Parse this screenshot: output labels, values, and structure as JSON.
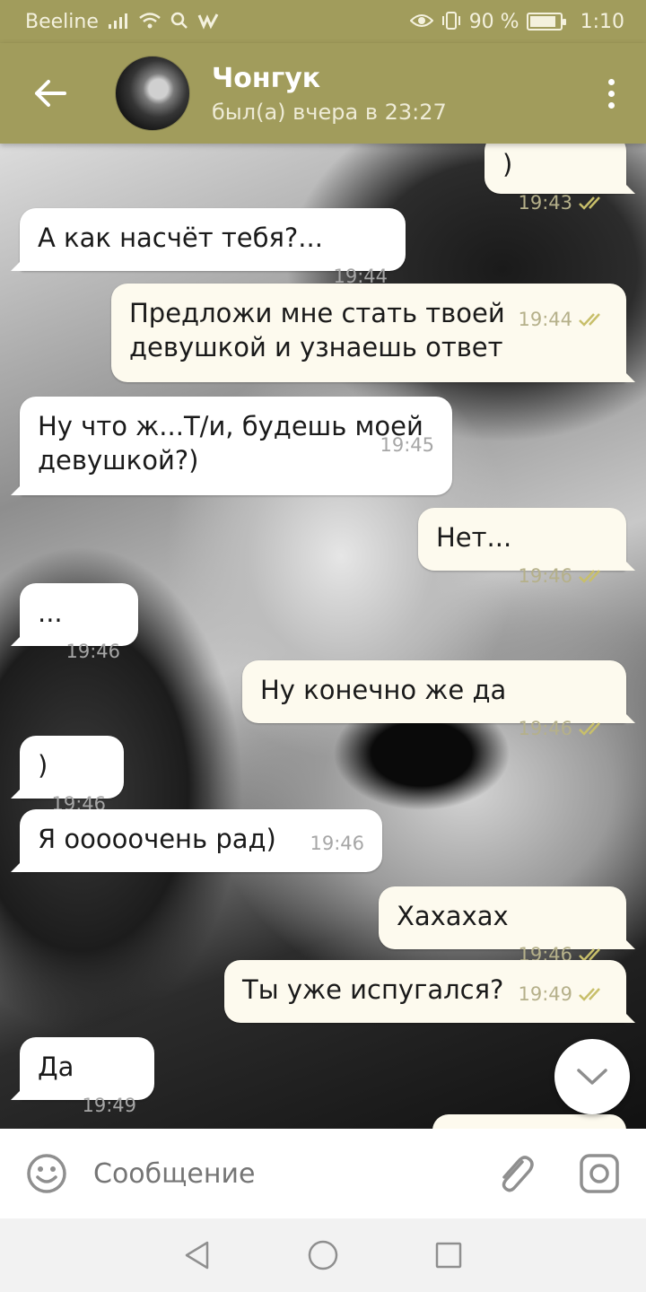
{
  "status_bar": {
    "carrier": "Beeline",
    "battery": "90 %",
    "battery_fraction": 0.9,
    "time": "1:10"
  },
  "header": {
    "name": "Чонгук",
    "status": "был(а) вчера в 23:27"
  },
  "messages": [
    {
      "dir": "out",
      "text": ")",
      "time": "19:43",
      "read": true
    },
    {
      "dir": "in",
      "text": "А как насчёт тебя?...",
      "time": "19:44"
    },
    {
      "dir": "out",
      "text": "Предложи мне стать твоей девушкой и узнаешь ответ",
      "time": "19:44",
      "read": true
    },
    {
      "dir": "in",
      "text": "Ну что ж...Т/и, будешь моей девушкой?)",
      "time": "19:45"
    },
    {
      "dir": "out",
      "text": "Нет...",
      "time": "19:46",
      "read": true
    },
    {
      "dir": "in",
      "text": "...",
      "time": "19:46"
    },
    {
      "dir": "out",
      "text": "Ну конечно же да",
      "time": "19:46",
      "read": true
    },
    {
      "dir": "in",
      "text": ")",
      "time": "19:46"
    },
    {
      "dir": "in",
      "text": "Я ооооочень рад)",
      "time": "19:46"
    },
    {
      "dir": "out",
      "text": "Хахахах",
      "time": "19:46",
      "read": true
    },
    {
      "dir": "out",
      "text": "Ты уже испугался?",
      "time": "19:49",
      "read": true
    },
    {
      "dir": "in",
      "text": "Да",
      "time": "19:49"
    }
  ],
  "input": {
    "placeholder": "Сообщение"
  },
  "colors": {
    "accent": "#a19c5c",
    "bubble_in": "#ffffff",
    "bubble_out": "#fdfaee",
    "read_ticks": "#c8bf6a"
  }
}
